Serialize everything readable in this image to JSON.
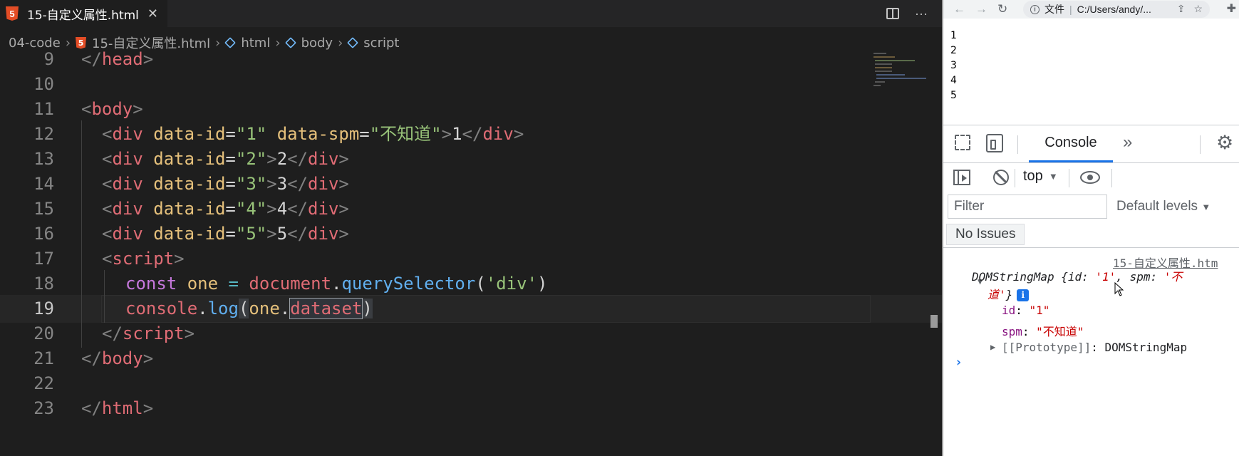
{
  "editor": {
    "tab_title": "15-自定义属性.html",
    "tab_close": "✕",
    "breadcrumb": [
      "04-code",
      "15-自定义属性.html",
      "html",
      "body",
      "script"
    ],
    "lines": [
      {
        "n": "9"
      },
      {
        "n": "10"
      },
      {
        "n": "11"
      },
      {
        "n": "12"
      },
      {
        "n": "13"
      },
      {
        "n": "14"
      },
      {
        "n": "15"
      },
      {
        "n": "16"
      },
      {
        "n": "17"
      },
      {
        "n": "18"
      },
      {
        "n": "19"
      },
      {
        "n": "20"
      },
      {
        "n": "21"
      },
      {
        "n": "22"
      },
      {
        "n": "23"
      }
    ],
    "code": {
      "l9": "</head>",
      "l11_tag": "body",
      "l12_attr2_val": "\"不知道\"",
      "l18_const": "const",
      "l18_var": "one",
      "l18_doc": "document",
      "l18_fn": "querySelector",
      "l18_arg": "'div'",
      "l19_console": "console",
      "l19_log": "log",
      "l19_one": "one",
      "l19_prop": "dataset"
    }
  },
  "browser": {
    "omnibox_scheme": "文件",
    "omnibox_url": "C:/Users/andy/...",
    "page_lines": [
      "1",
      "2",
      "3",
      "4",
      "5"
    ],
    "devtools": {
      "tab_console": "Console",
      "context": "top",
      "filter_placeholder": "Filter",
      "levels": "Default levels",
      "issues": "No Issues",
      "source_link": "15-自定义属性.htm",
      "obj_summary_a": "DOMStringMap {id: ",
      "obj_id_val": "'1'",
      "obj_summary_b": ", spm: ",
      "obj_spm_val_start": "'不",
      "obj_spm_val_end": "道'",
      "obj_close": "}",
      "props": [
        {
          "key": "id",
          "value": "\"1\""
        },
        {
          "key": "spm",
          "value": "\"不知道\""
        }
      ],
      "proto_key": "[[Prototype]]",
      "proto_val": "DOMStringMap",
      "prompt": "›"
    }
  }
}
